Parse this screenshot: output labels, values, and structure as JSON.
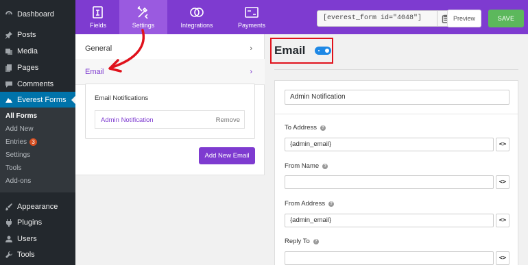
{
  "sidebar": {
    "items": [
      {
        "label": "Dashboard",
        "icon": "dashboard-icon"
      },
      {
        "label": "Posts",
        "icon": "pin-icon"
      },
      {
        "label": "Media",
        "icon": "media-icon"
      },
      {
        "label": "Pages",
        "icon": "pages-icon"
      },
      {
        "label": "Comments",
        "icon": "comments-icon"
      },
      {
        "label": "Everest Forms",
        "icon": "everest-forms-icon"
      }
    ],
    "submenu": [
      {
        "label": "All Forms"
      },
      {
        "label": "Add New"
      },
      {
        "label": "Entries",
        "badge": "3"
      },
      {
        "label": "Settings"
      },
      {
        "label": "Tools"
      },
      {
        "label": "Add-ons"
      }
    ],
    "bottom_items": [
      {
        "label": "Appearance",
        "icon": "paintbrush-icon"
      },
      {
        "label": "Plugins",
        "icon": "plugin-icon"
      },
      {
        "label": "Users",
        "icon": "users-icon"
      },
      {
        "label": "Tools",
        "icon": "wrench-icon"
      }
    ]
  },
  "toolbar": {
    "tabs": [
      {
        "label": "Fields",
        "icon": "fields-icon"
      },
      {
        "label": "Settings",
        "icon": "settings-tools-icon"
      },
      {
        "label": "Integrations",
        "icon": "integrations-icon"
      },
      {
        "label": "Payments",
        "icon": "payments-icon"
      }
    ],
    "shortcode": "[everest_form id=\"4048\"]",
    "preview_label": "Preview",
    "save_label": "SAVE"
  },
  "settings_menu": {
    "general_label": "General",
    "email_label": "Email",
    "chevron": "›"
  },
  "notifications": {
    "title": "Email Notifications",
    "item_name": "Admin Notification",
    "remove_label": "Remove",
    "add_button": "Add New Email"
  },
  "email_panel": {
    "title": "Email",
    "enabled": true,
    "notification_name": "Admin Notification",
    "fields": [
      {
        "label": "To Address",
        "value": "{admin_email}"
      },
      {
        "label": "From Name",
        "value": ""
      },
      {
        "label": "From Address",
        "value": "{admin_email}"
      },
      {
        "label": "Reply To",
        "value": ""
      }
    ],
    "help_glyph": "?",
    "tag_glyph": "<>"
  },
  "colors": {
    "accent": "#7e3bd0",
    "save": "#5cb85c",
    "toggle": "#1e88e5",
    "annotation": "#e0121c",
    "wp_active": "#0073aa"
  }
}
